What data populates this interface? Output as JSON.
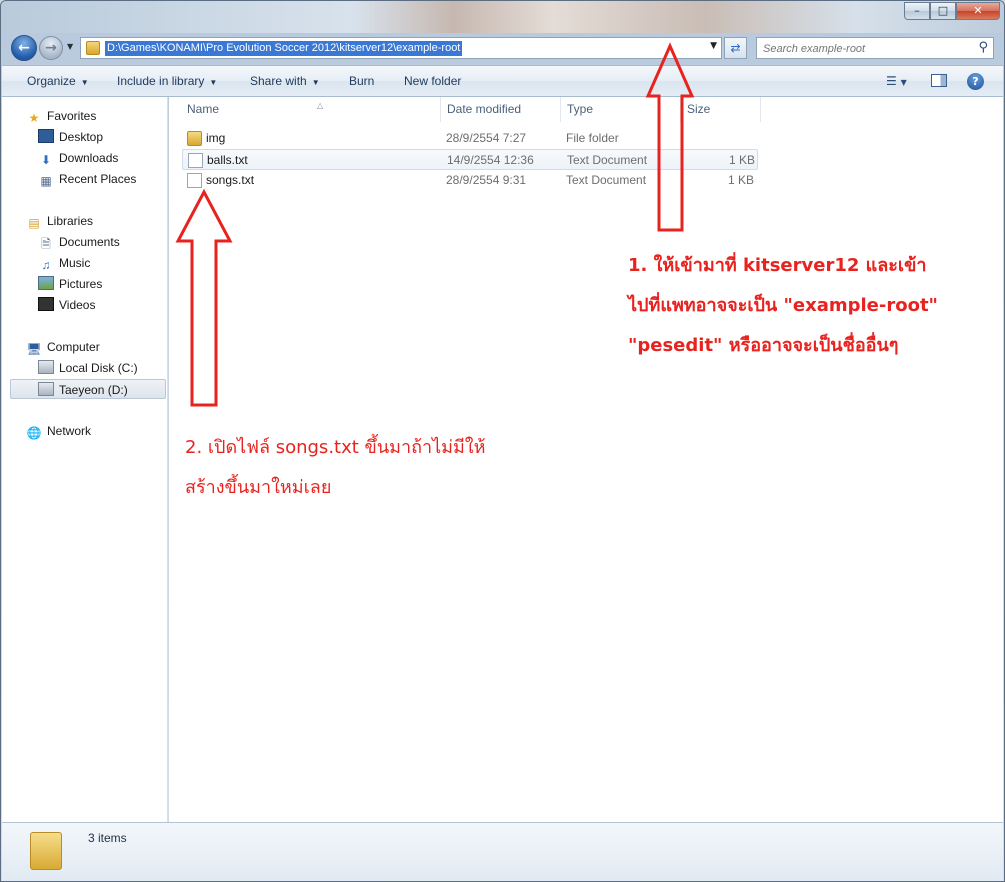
{
  "address_bar": {
    "path": "D:\\Games\\KONAMI\\Pro Evolution Soccer 2012\\kitserver12\\example-root"
  },
  "search": {
    "placeholder": "Search example-root"
  },
  "toolbar": {
    "organize": "Organize",
    "include_in_library": "Include in library",
    "share_with": "Share with",
    "burn": "Burn",
    "new_folder": "New folder"
  },
  "sidebar": {
    "favorites": "Favorites",
    "desktop": "Desktop",
    "downloads": "Downloads",
    "recent_places": "Recent Places",
    "libraries": "Libraries",
    "documents": "Documents",
    "music": "Music",
    "pictures": "Pictures",
    "videos": "Videos",
    "computer": "Computer",
    "local_disk": "Local Disk (C:)",
    "taeyeon": "Taeyeon (D:)",
    "network": "Network"
  },
  "columns": {
    "name": "Name",
    "date_modified": "Date modified",
    "type": "Type",
    "size": "Size"
  },
  "files": [
    {
      "name": "img",
      "date": "28/9/2554 7:27",
      "type": "File folder",
      "size": "",
      "icon": "folder-icon"
    },
    {
      "name": "balls.txt",
      "date": "14/9/2554 12:36",
      "type": "Text Document",
      "size": "1 KB",
      "icon": "text-file-icon"
    },
    {
      "name": "songs.txt",
      "date": "28/9/2554 9:31",
      "type": "Text Document",
      "size": "1 KB",
      "icon": "text-file-icon"
    }
  ],
  "annotations": {
    "note1_line1": "1. ให้เข้ามาที่   kitserver12 และเข้า",
    "note1_line2": "ไปที่แพทอาจจะเป็น   \"example-root\"",
    "note1_line3": "\"pesedit\" หรืออาจจะเป็นชื่ออื่นๆ",
    "note2_line1": "2. เปิดไฟล์   songs.txt ขึ้นมาถ้าไม่มีให้",
    "note2_line2": "สร้างขึ้นมาใหม่เลย"
  },
  "status": {
    "items": "3 items"
  },
  "colors": {
    "annotation": "#e8231f",
    "accent": "#3a78d6"
  }
}
